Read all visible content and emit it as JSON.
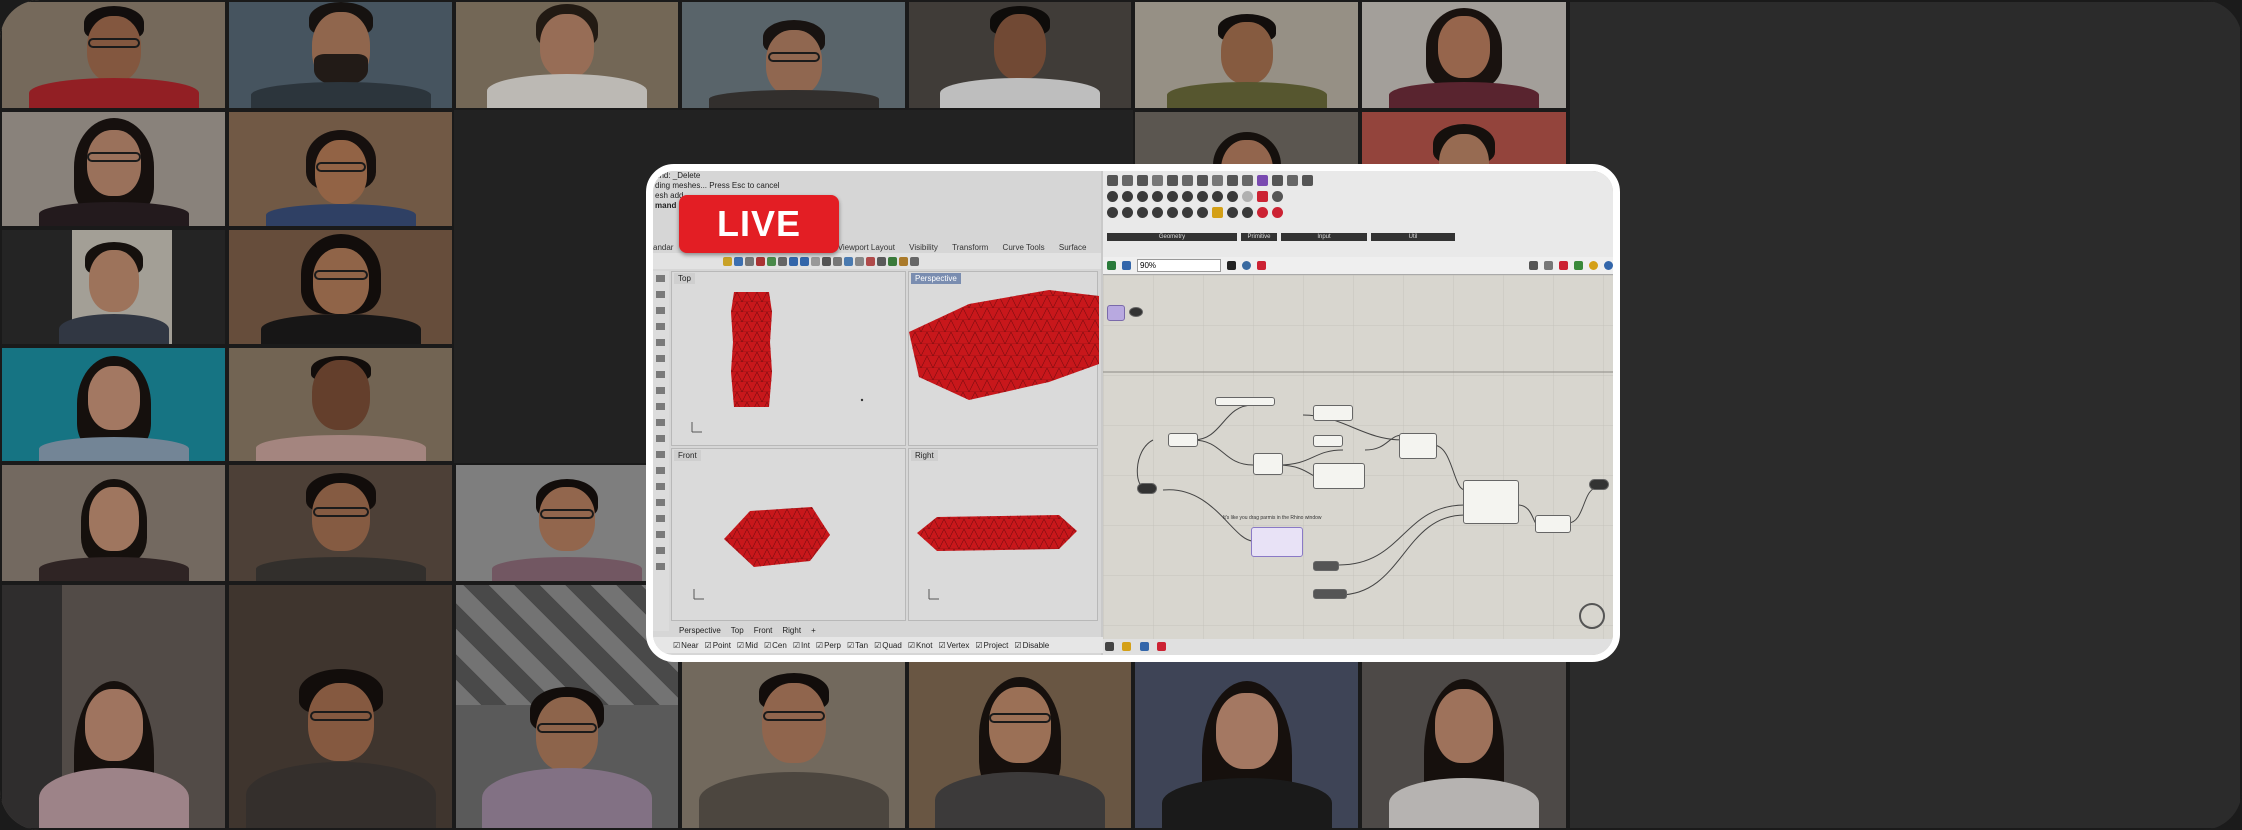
{
  "live_badge": "LIVE",
  "colors": {
    "live_red": "#e31e24",
    "mesh_red": "#c8171b",
    "grid_bg": "#222222"
  },
  "rhino": {
    "command_lines": [
      "and: _Delete",
      "ding meshes... Press Esc to cancel",
      "esh add",
      "mand"
    ],
    "toolbar_tabs": [
      "andar",
      "Viewport Layout",
      "Visibility",
      "Transform",
      "Curve Tools",
      "Surface"
    ],
    "viewports": [
      {
        "label": "Top",
        "active": false
      },
      {
        "label": "Perspective",
        "active": true
      },
      {
        "label": "Front",
        "active": false
      },
      {
        "label": "Right",
        "active": false
      }
    ],
    "viewport_tabs": [
      "Perspective",
      "Top",
      "Front",
      "Right"
    ],
    "osnaps": [
      "Near",
      "Point",
      "Mid",
      "Cen",
      "Int",
      "Perp",
      "Tan",
      "Quad",
      "Knot",
      "Vertex",
      "Project",
      "Disable"
    ]
  },
  "grasshopper": {
    "categories": [
      "Geometry",
      "Primitive",
      "Input",
      "Util"
    ],
    "zoom": "90%",
    "note": "It's like you drag parmis in the Rhino window"
  }
}
